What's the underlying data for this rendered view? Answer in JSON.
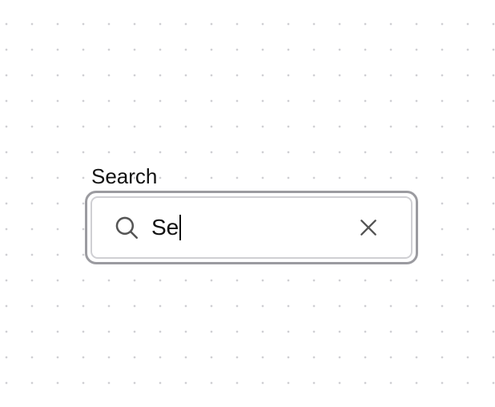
{
  "search": {
    "label": "Search",
    "value": "Se",
    "icons": {
      "leading": "search-icon",
      "trailing": "close-icon"
    }
  },
  "colors": {
    "text": "#111111",
    "icon": "#555555",
    "focus_ring": "#9b9ba0",
    "input_border": "#cfcfd3",
    "background_dots": "#cfcfd3"
  }
}
